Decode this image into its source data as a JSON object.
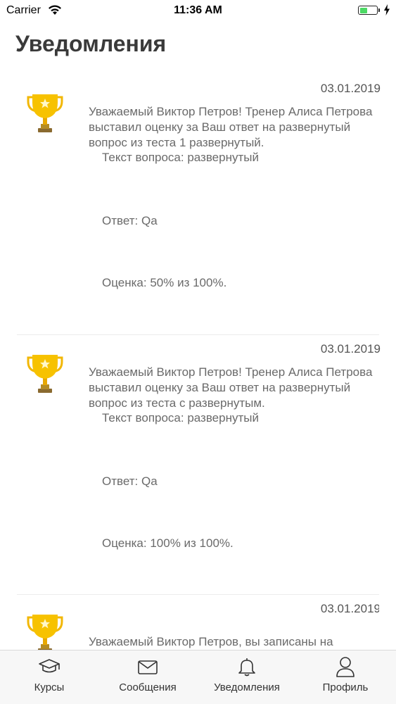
{
  "status_bar": {
    "carrier": "Carrier",
    "time": "11:36 AM",
    "battery_level": 0.4
  },
  "header": {
    "title": "Уведомления"
  },
  "notifications": [
    {
      "icon": "trophy-icon",
      "date": "03.01.2019",
      "message": "Уважаемый Виктор Петров! Тренер Алиса Петрова выставил оценку за Ваш ответ на развернутый вопрос из теста 1 развернутый.",
      "question": "Текст вопроса: развернутый",
      "answer": "Ответ: Qa",
      "grade": "Оценка: 50% из 100%."
    },
    {
      "icon": "trophy-icon",
      "date": "03.01.2019",
      "message": "Уважаемый Виктор Петров! Тренер Алиса Петрова выставил оценку за Ваш ответ на развернутый вопрос из теста с развернутым.",
      "question": "Текст вопроса: развернутый",
      "answer": "Ответ: Qa",
      "grade": "Оценка: 100% из 100%."
    },
    {
      "icon": "trophy-icon",
      "date": "03.01.2019",
      "message": "Уважаемый Виктор Петров, вы записаны на"
    }
  ],
  "tabbar": {
    "tabs": [
      {
        "label": "Курсы",
        "icon": "graduation-cap-icon"
      },
      {
        "label": "Сообщения",
        "icon": "envelope-icon"
      },
      {
        "label": "Уведомления",
        "icon": "bell-icon"
      },
      {
        "label": "Профиль",
        "icon": "person-icon"
      }
    ]
  }
}
